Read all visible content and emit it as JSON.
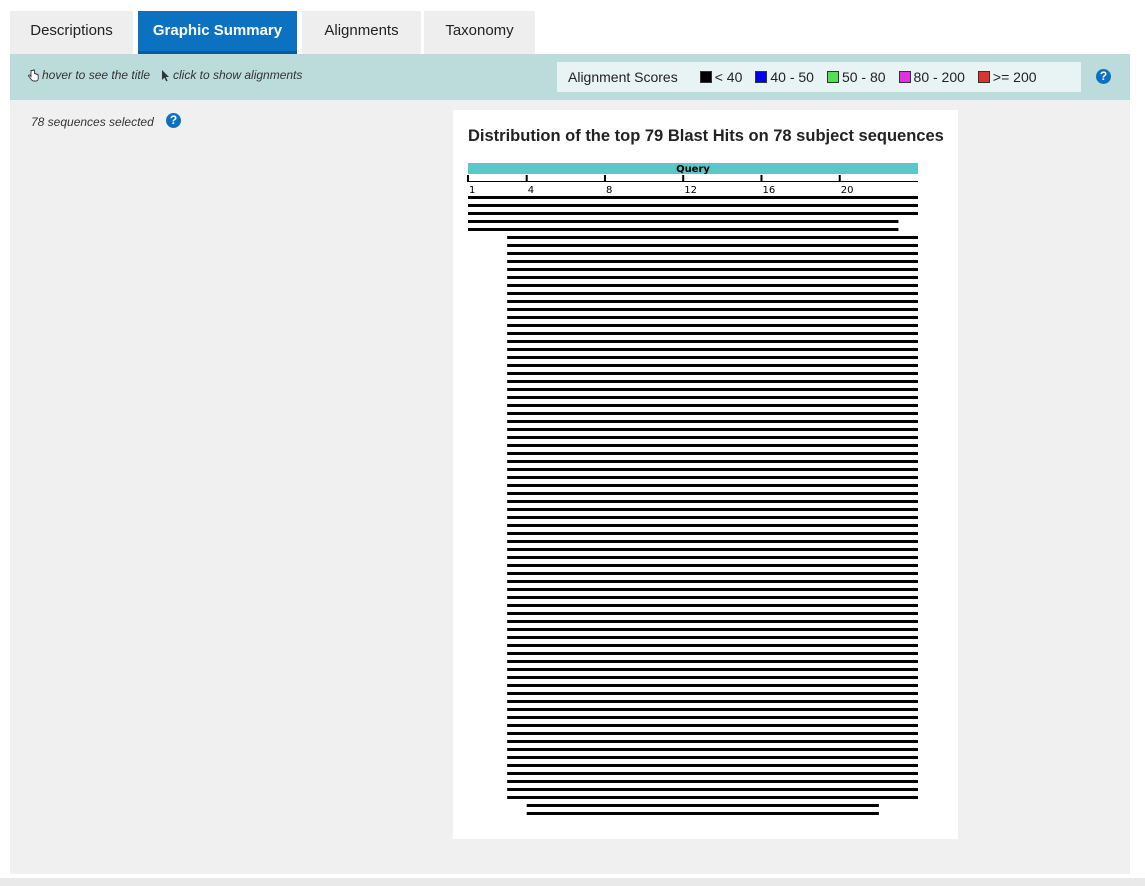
{
  "tabs": [
    {
      "label": "Descriptions",
      "active": false
    },
    {
      "label": "Graphic Summary",
      "active": true
    },
    {
      "label": "Alignments",
      "active": false
    },
    {
      "label": "Taxonomy",
      "active": false
    }
  ],
  "toolbar": {
    "hover_hint": "hover to see the title",
    "click_hint": "click to show alignments",
    "help_icon": "question-circle-icon"
  },
  "legend": {
    "title": "Alignment Scores",
    "items": [
      {
        "label": "< 40",
        "color": "#000000"
      },
      {
        "label": "40 - 50",
        "color": "#0000ee"
      },
      {
        "label": "50 - 80",
        "color": "#55dd55"
      },
      {
        "label": "80 - 200",
        "color": "#dd33dd"
      },
      {
        "label": ">= 200",
        "color": "#dd3333"
      }
    ]
  },
  "selection": {
    "text": "78 sequences selected"
  },
  "chart_data": {
    "type": "bar",
    "title": "Distribution of the top 79 Blast Hits on 78 subject sequences",
    "query_label": "Query",
    "query_color": "#5bc8c8",
    "query_length": 24,
    "ticks": [
      1,
      4,
      8,
      12,
      16,
      20
    ],
    "hit_color": "#000000",
    "hits": [
      {
        "start": 1,
        "end": 24
      },
      {
        "start": 1,
        "end": 24
      },
      {
        "start": 1,
        "end": 24
      },
      {
        "start": 1,
        "end": 23
      },
      {
        "start": 1,
        "end": 23
      },
      {
        "start": 3,
        "end": 24,
        "repeat": 71
      },
      {
        "start": 4,
        "end": 22
      },
      {
        "start": 4,
        "end": 22
      }
    ]
  }
}
